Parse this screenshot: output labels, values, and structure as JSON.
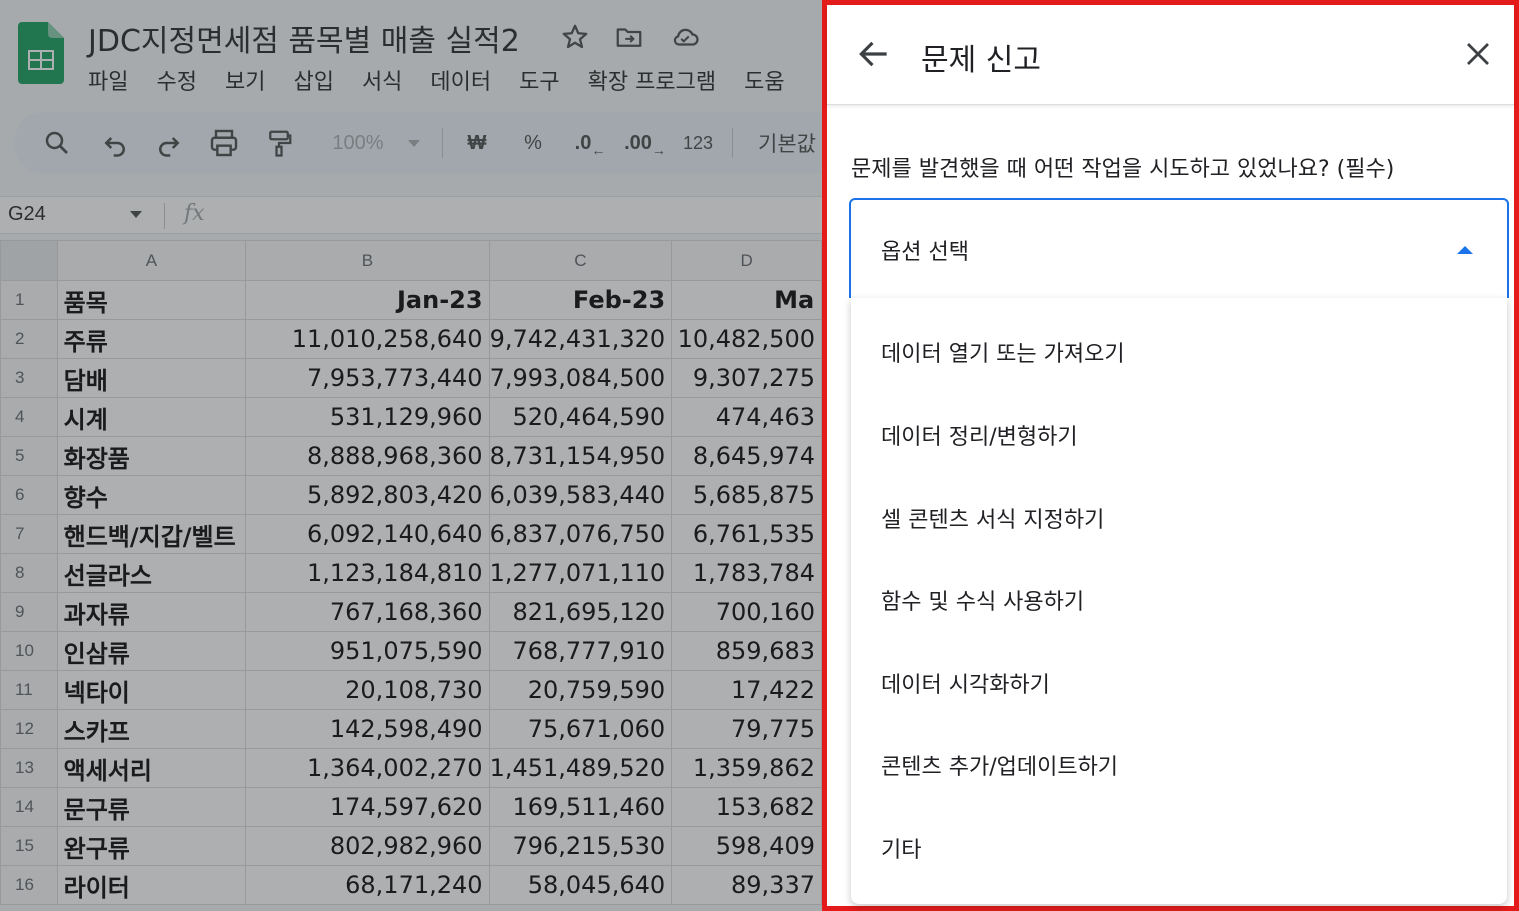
{
  "sheet": {
    "doc_title": "JDC지정면세점 품목별 매출 실적2",
    "menu": [
      "파일",
      "수정",
      "보기",
      "삽입",
      "서식",
      "데이터",
      "도구",
      "확장 프로그램",
      "도움"
    ],
    "toolbar": {
      "zoom": "100%",
      "currency": "₩",
      "percent": "%",
      "decrease_decimal": ".0",
      "increase_decimal": ".00",
      "number_format": "123",
      "font": "기본값"
    },
    "name_box": "G24",
    "fx_label": "fx",
    "columns": [
      "A",
      "B",
      "C",
      "D"
    ],
    "header_row": {
      "num": "1",
      "name": "품목",
      "b": "Jan-23",
      "c": "Feb-23",
      "d": "Ma"
    },
    "rows": [
      {
        "num": "2",
        "name": "주류",
        "b": "11,010,258,640",
        "c": "9,742,431,320",
        "d": "10,482,500"
      },
      {
        "num": "3",
        "name": "담배",
        "b": "7,953,773,440",
        "c": "7,993,084,500",
        "d": "9,307,275"
      },
      {
        "num": "4",
        "name": "시계",
        "b": "531,129,960",
        "c": "520,464,590",
        "d": "474,463"
      },
      {
        "num": "5",
        "name": "화장품",
        "b": "8,888,968,360",
        "c": "8,731,154,950",
        "d": "8,645,974"
      },
      {
        "num": "6",
        "name": "향수",
        "b": "5,892,803,420",
        "c": "6,039,583,440",
        "d": "5,685,875"
      },
      {
        "num": "7",
        "name": "핸드백/지갑/벨트",
        "b": "6,092,140,640",
        "c": "6,837,076,750",
        "d": "6,761,535"
      },
      {
        "num": "8",
        "name": "선글라스",
        "b": "1,123,184,810",
        "c": "1,277,071,110",
        "d": "1,783,784"
      },
      {
        "num": "9",
        "name": "과자류",
        "b": "767,168,360",
        "c": "821,695,120",
        "d": "700,160"
      },
      {
        "num": "10",
        "name": "인삼류",
        "b": "951,075,590",
        "c": "768,777,910",
        "d": "859,683"
      },
      {
        "num": "11",
        "name": "넥타이",
        "b": "20,108,730",
        "c": "20,759,590",
        "d": "17,422"
      },
      {
        "num": "12",
        "name": "스카프",
        "b": "142,598,490",
        "c": "75,671,060",
        "d": "79,775"
      },
      {
        "num": "13",
        "name": "액세서리",
        "b": "1,364,002,270",
        "c": "1,451,489,520",
        "d": "1,359,862"
      },
      {
        "num": "14",
        "name": "문구류",
        "b": "174,597,620",
        "c": "169,511,460",
        "d": "153,682"
      },
      {
        "num": "15",
        "name": "완구류",
        "b": "802,982,960",
        "c": "796,215,530",
        "d": "598,409"
      },
      {
        "num": "16",
        "name": "라이터",
        "b": "68,171,240",
        "c": "58,045,640",
        "d": "89,337"
      }
    ]
  },
  "report": {
    "title": "문제 신고",
    "question": "문제를 발견했을 때 어떤 작업을 시도하고 있었나요? (필수)",
    "select_placeholder": "옵션 선택",
    "options": [
      "데이터 열기 또는 가져오기",
      "데이터 정리/변형하기",
      "셀 콘텐츠 서식 지정하기",
      "함수 및 수식 사용하기",
      "데이터 시각화하기",
      "콘텐츠 추가/업데이트하기",
      "기타"
    ],
    "colors": {
      "accent": "#1a73e8",
      "highlight_border": "#e31b1b"
    }
  }
}
